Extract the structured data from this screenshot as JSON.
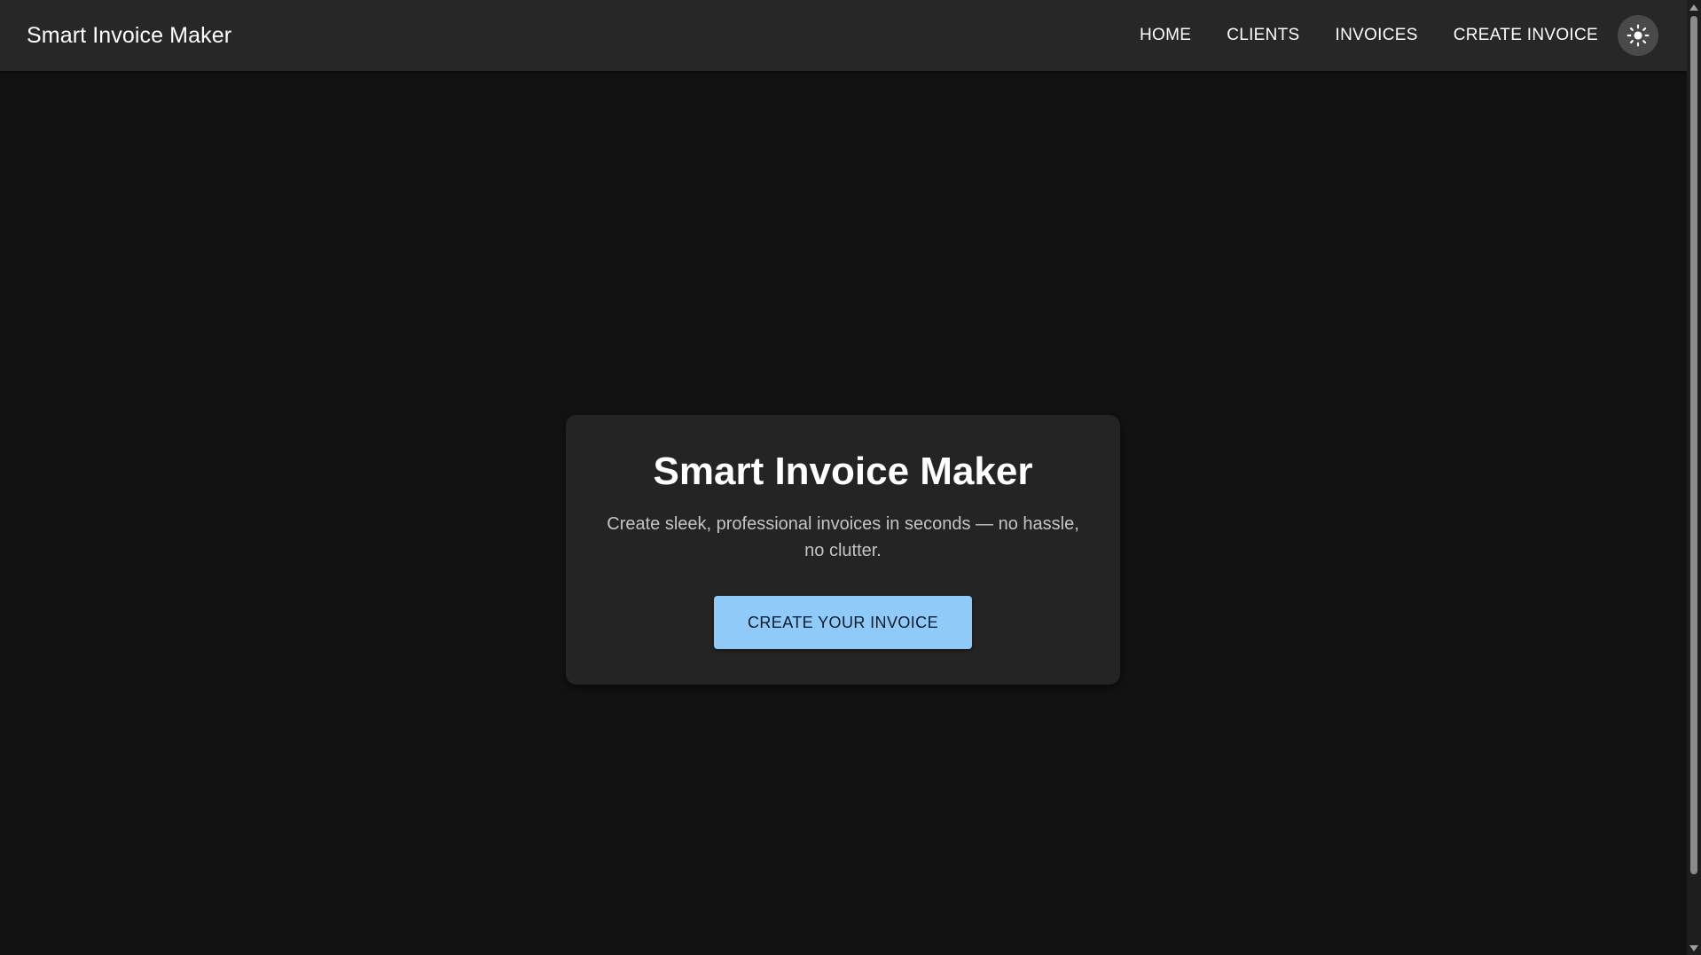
{
  "app": {
    "title": "Smart Invoice Maker"
  },
  "nav": {
    "items": [
      {
        "label": "HOME"
      },
      {
        "label": "CLIENTS"
      },
      {
        "label": "INVOICES"
      },
      {
        "label": "CREATE INVOICE"
      }
    ],
    "theme_toggle_icon": "sun-icon"
  },
  "hero": {
    "title": "Smart Invoice Maker",
    "subtitle": "Create sleek, professional invoices in seconds — no hassle, no clutter.",
    "cta_label": "CREATE YOUR INVOICE"
  },
  "colors": {
    "background": "#121212",
    "appbar": "#272727",
    "card": "#242424",
    "accent": "#90caf9"
  }
}
